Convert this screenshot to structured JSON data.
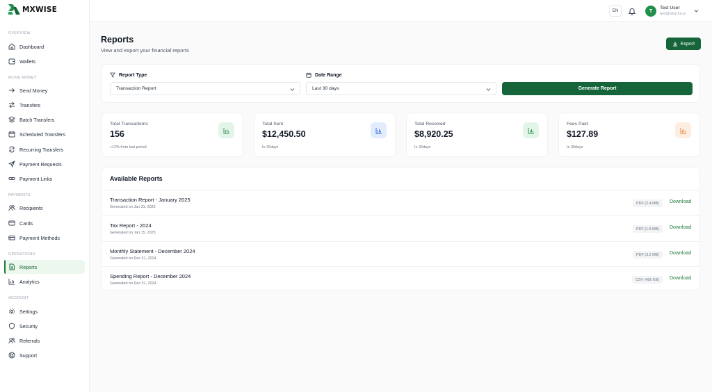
{
  "brand": {
    "name": "MXWISE",
    "accent": "#16653a"
  },
  "sidebar": {
    "sections": [
      {
        "label": "OVERVIEW",
        "items": [
          {
            "label": "Dashboard",
            "icon": "home-icon"
          },
          {
            "label": "Wallets",
            "icon": "wallet-icon"
          }
        ]
      },
      {
        "label": "MOVE MONEY",
        "items": [
          {
            "label": "Send Money",
            "icon": "send-icon"
          },
          {
            "label": "Transfers",
            "icon": "arrows-swap-icon"
          },
          {
            "label": "Batch Transfers",
            "icon": "layers-icon"
          },
          {
            "label": "Scheduled Transfers",
            "icon": "calendar-icon"
          },
          {
            "label": "Recurring Transfers",
            "icon": "repeat-icon"
          },
          {
            "label": "Payment Requests",
            "icon": "paper-plane-icon"
          },
          {
            "label": "Payment Links",
            "icon": "link-icon"
          }
        ]
      },
      {
        "label": "PAYMENTS",
        "items": [
          {
            "label": "Recipients",
            "icon": "users-icon"
          },
          {
            "label": "Cards",
            "icon": "credit-card-icon"
          },
          {
            "label": "Payment Methods",
            "icon": "card-stack-icon"
          }
        ]
      },
      {
        "label": "OPERATIONS",
        "items": [
          {
            "label": "Reports",
            "icon": "file-text-icon",
            "active": true
          },
          {
            "label": "Analytics",
            "icon": "bar-chart-icon"
          }
        ]
      },
      {
        "label": "ACCOUNT",
        "items": [
          {
            "label": "Settings",
            "icon": "gear-icon"
          },
          {
            "label": "Security",
            "icon": "shield-icon"
          },
          {
            "label": "Referrals",
            "icon": "user-plus-icon"
          },
          {
            "label": "Support",
            "icon": "lifebuoy-icon"
          }
        ]
      }
    ]
  },
  "topbar": {
    "lang": "EN",
    "user": {
      "initial": "T",
      "name": "Test User",
      "email": "test@wise.local"
    }
  },
  "header": {
    "title": "Reports",
    "subtitle": "View and export your financial reports",
    "export_label": "Export"
  },
  "filters": {
    "report_type_label": "Report Type",
    "report_type_value": "Transaction Report",
    "date_range_label": "Date Range",
    "date_range_value": "Last 30 days",
    "generate_label": "Generate Report"
  },
  "stats": [
    {
      "label": "Total Transactions",
      "value": "156",
      "sub": "+12% from last period",
      "icon_color": "#1f8f4a",
      "icon_bg": "#e3f5e8"
    },
    {
      "label": "Total Sent",
      "value": "$12,450.50",
      "sub": "In 30days",
      "icon_color": "#2563eb",
      "icon_bg": "#e2ecfc"
    },
    {
      "label": "Total Received",
      "value": "$8,920.25",
      "sub": "In 30days",
      "icon_color": "#1f8f4a",
      "icon_bg": "#e3f5e8"
    },
    {
      "label": "Fees Paid",
      "value": "$127.89",
      "sub": "In 30days",
      "icon_color": "#ea7a2a",
      "icon_bg": "#fdeee2"
    }
  ],
  "reports": {
    "title": "Available Reports",
    "download_label": "Download",
    "items": [
      {
        "name": "Transaction Report - January 2025",
        "date": "Generated on Jan 31, 2025",
        "badge": "PDF (2.4 MB)"
      },
      {
        "name": "Tax Report - 2024",
        "date": "Generated on Jan 15, 2025",
        "badge": "PDF (1.8 MB)"
      },
      {
        "name": "Monthly Statement - December 2024",
        "date": "Generated on Dec 31, 2024",
        "badge": "PDF (3.2 MB)"
      },
      {
        "name": "Spending Report - December 2024",
        "date": "Generated on Dec 31, 2024",
        "badge": "CSV (456 KB)"
      }
    ]
  }
}
